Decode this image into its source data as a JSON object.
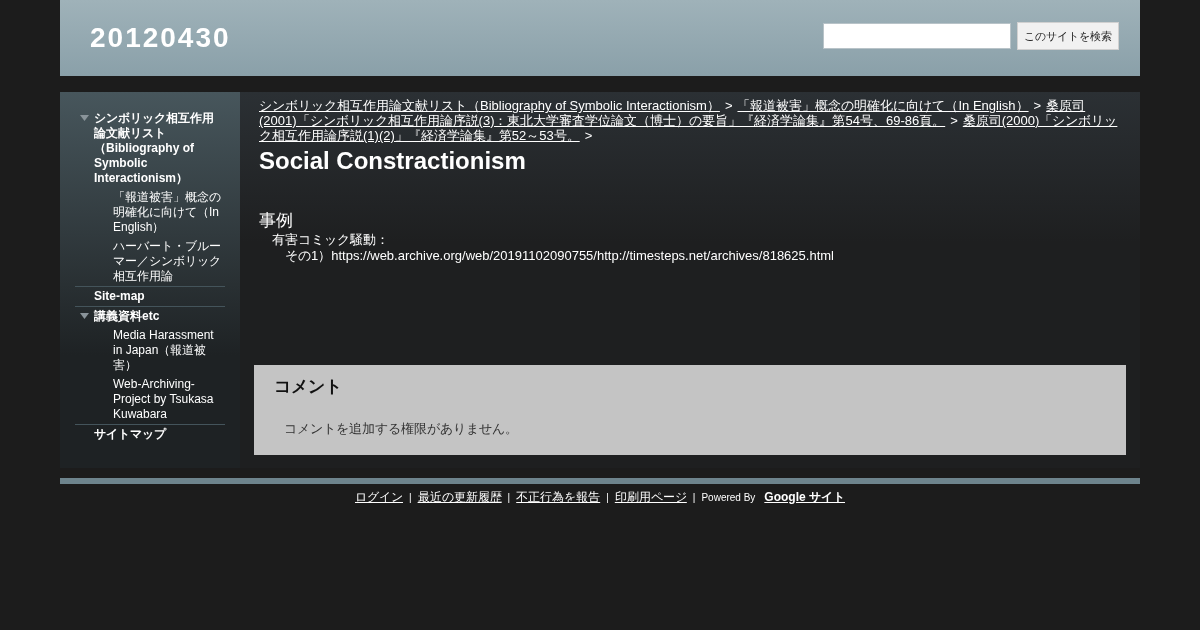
{
  "header": {
    "site_title": "20120430",
    "search": {
      "button": "このサイトを検索"
    }
  },
  "sidebar": {
    "items": [
      {
        "label": "シンボリック相互作用論文献リスト（Bibliography of Symbolic Interactionism）",
        "expanded": true,
        "children": [
          {
            "label": "「報道被害」概念の明確化に向けて（In English）"
          },
          {
            "label": "ハーバート・ブルーマー／シンボリック相互作用論"
          }
        ]
      },
      {
        "label": "Site-map"
      },
      {
        "label": "講義資料etc",
        "expanded": true,
        "children": [
          {
            "label": "Media Harassment in Japan（報道被害）"
          },
          {
            "label": "Web-Archiving-Project by Tsukasa Kuwabara"
          }
        ]
      },
      {
        "label": "サイトマップ"
      }
    ]
  },
  "breadcrumb": {
    "separator": ">",
    "links": [
      {
        "parts": [
          "シンボリック相互作用論文献リスト（Bibliography of Symbolic Interactionism）"
        ]
      },
      {
        "parts": [
          "「報道被害」概念の明確化に向けて（In English）"
        ]
      },
      {
        "parts": [
          "桑原司",
          "(2001)「シンボリック相互作用論序説(3)：東北大学審査学位論文（博士）の要旨」『経済学論集』第54号、69-86頁。"
        ]
      },
      {
        "parts": [
          "桑原司(2000)「シンボリッ",
          "ク相互作用論序説(1)(2)」『経済学論集』第52～53号。"
        ]
      }
    ]
  },
  "page_title": "Social Constractionism",
  "section": {
    "heading": "事例",
    "lines": [
      "有害コミック騒動：",
      "その1）https://web.archive.org/web/20191102090755/http://timesteps.net/archives/818625.html"
    ]
  },
  "comments": {
    "heading": "コメント",
    "message": "コメントを追加する権限がありません。"
  },
  "footer": {
    "links": [
      "ログイン",
      "最近の更新履歴",
      "不正行為を報告",
      "印刷用ページ"
    ],
    "separator": "|",
    "powered_by": "Powered By",
    "brand": "Google サイト"
  }
}
